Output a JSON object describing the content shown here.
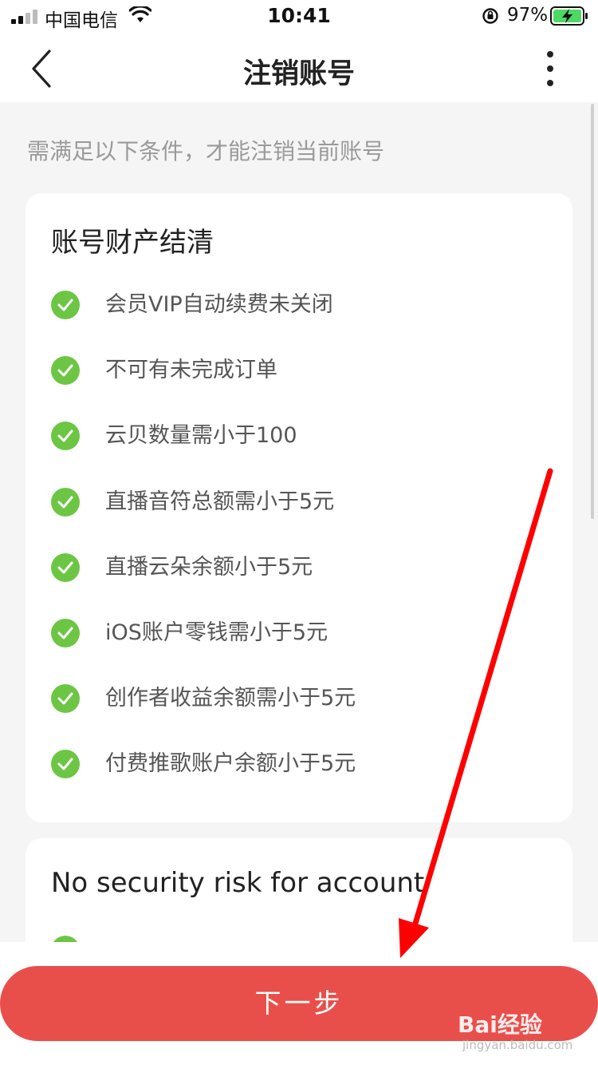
{
  "status_bar": {
    "carrier": "中国电信",
    "time": "10:41",
    "battery_percent": "97%",
    "icons": [
      "signal-icon",
      "wifi-icon",
      "orientation-lock-icon",
      "battery-charging-icon"
    ]
  },
  "nav": {
    "title": "注销账号",
    "back_icon": "chevron-left-icon",
    "more_icon": "more-vertical-icon"
  },
  "hint": "需满足以下条件，才能注销当前账号",
  "sections": [
    {
      "title": "账号财产结清",
      "items": [
        {
          "label": "会员VIP自动续费未关闭",
          "status": "checked"
        },
        {
          "label": "不可有未完成订单",
          "status": "checked"
        },
        {
          "label": "云贝数量需小于100",
          "status": "checked"
        },
        {
          "label": "直播音符总额需小于5元",
          "status": "checked"
        },
        {
          "label": "直播云朵余额小于5元",
          "status": "checked"
        },
        {
          "label": "iOS账户零钱需小于5元",
          "status": "checked"
        },
        {
          "label": "创作者收益余额需小于5元",
          "status": "checked"
        },
        {
          "label": "付费推歌账户余额小于5元",
          "status": "checked"
        }
      ]
    },
    {
      "title": "No security risk for account"
    }
  ],
  "next_button_label": "下一步",
  "watermark": {
    "text": "Bai经验",
    "sub": "jingyan.baidu.com"
  },
  "colors": {
    "accent": "#e94f4a",
    "check": "#6cc644",
    "annotation_arrow": "#ff0000",
    "background": "#f5f5f5"
  }
}
